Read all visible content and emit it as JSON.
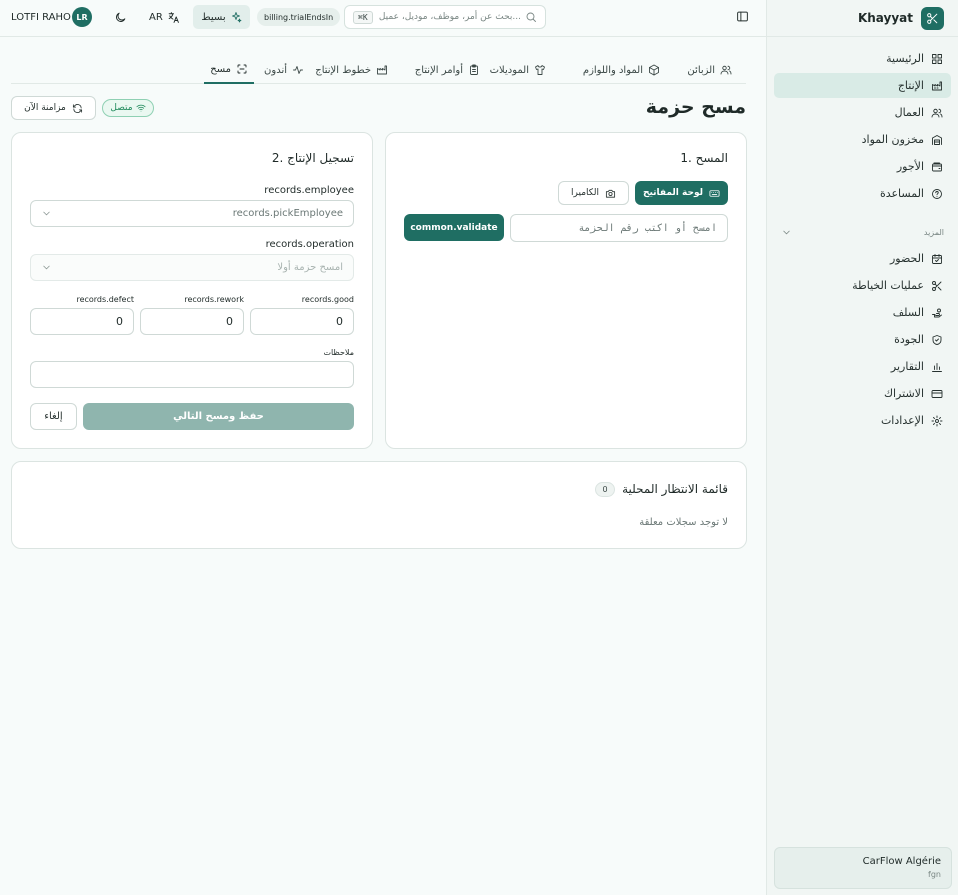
{
  "app": {
    "name": "Khayyat"
  },
  "sidebar": {
    "main_items": [
      {
        "label": "الرئيسية",
        "icon": "dashboard-icon"
      },
      {
        "label": "الإنتاج",
        "icon": "factory-icon",
        "active": true
      },
      {
        "label": "العمال",
        "icon": "users-icon"
      },
      {
        "label": "مخزون المواد",
        "icon": "warehouse-icon"
      },
      {
        "label": "الأجور",
        "icon": "wallet-icon"
      },
      {
        "label": "المساعدة",
        "icon": "help-circle-icon"
      }
    ],
    "more_label": "المزيد",
    "more_items": [
      {
        "label": "الحضور",
        "icon": "calendar-check-icon"
      },
      {
        "label": "عمليات الخياطة",
        "icon": "scissors-icon"
      },
      {
        "label": "السلف",
        "icon": "hand-coins-icon"
      },
      {
        "label": "الجودة",
        "icon": "shield-check-icon"
      },
      {
        "label": "التقارير",
        "icon": "bar-chart-icon"
      },
      {
        "label": "الاشتراك",
        "icon": "credit-card-icon"
      },
      {
        "label": "الإعدادات",
        "icon": "gear-icon"
      }
    ],
    "org": {
      "name": "CarFlow Algérie",
      "sub": "fgn"
    }
  },
  "topbar": {
    "user_name": "LOTFI RAHO",
    "avatar_initials": "LR",
    "lang": "AR",
    "mode_label": "بسيط",
    "trial_label": "billing.trialEndsIn",
    "search_placeholder": "بحث عن أمر، موظف، موديل، عميل...",
    "search_shortcut": "⌘K"
  },
  "tabs": [
    {
      "label": "الزبائن",
      "icon": "users-icon"
    },
    {
      "label": "المواد واللوازم",
      "icon": "box-icon"
    },
    {
      "label": "الموديلات",
      "icon": "shirt-icon"
    },
    {
      "label": "أوامر الإنتاج",
      "icon": "clipboard-icon"
    },
    {
      "label": "خطوط الإنتاج",
      "icon": "factory-icon"
    },
    {
      "label": "أندون",
      "icon": "activity-icon"
    },
    {
      "label": "مسح",
      "icon": "scan-icon",
      "active": true
    }
  ],
  "page": {
    "title": "مسح حزمة",
    "status": "متصل",
    "sync_label": "مزامنة الآن"
  },
  "scan": {
    "title": "1. المسح",
    "keyboard_label": "لوحة المفاتيح",
    "camera_label": "الكاميرا",
    "input_placeholder": "امسح أو اكتب رقم الحزمة",
    "validate_label": "common.validate"
  },
  "record": {
    "title": "2. تسجيل الإنتاج",
    "employee_label": "records.employee",
    "employee_placeholder": "records.pickEmployee",
    "operation_label": "records.operation",
    "operation_placeholder": "امسح حزمة أولا",
    "good_label": "records.good",
    "rework_label": "records.rework",
    "defect_label": "records.defect",
    "good_value": "0",
    "rework_value": "0",
    "defect_value": "0",
    "notes_label": "ملاحظات",
    "save_label": "حفظ ومسح التالي",
    "cancel_label": "إلغاء"
  },
  "queue": {
    "title": "قائمة الانتظار المحلية",
    "count": "0",
    "empty_text": "لا توجد سجلات معلقة"
  }
}
